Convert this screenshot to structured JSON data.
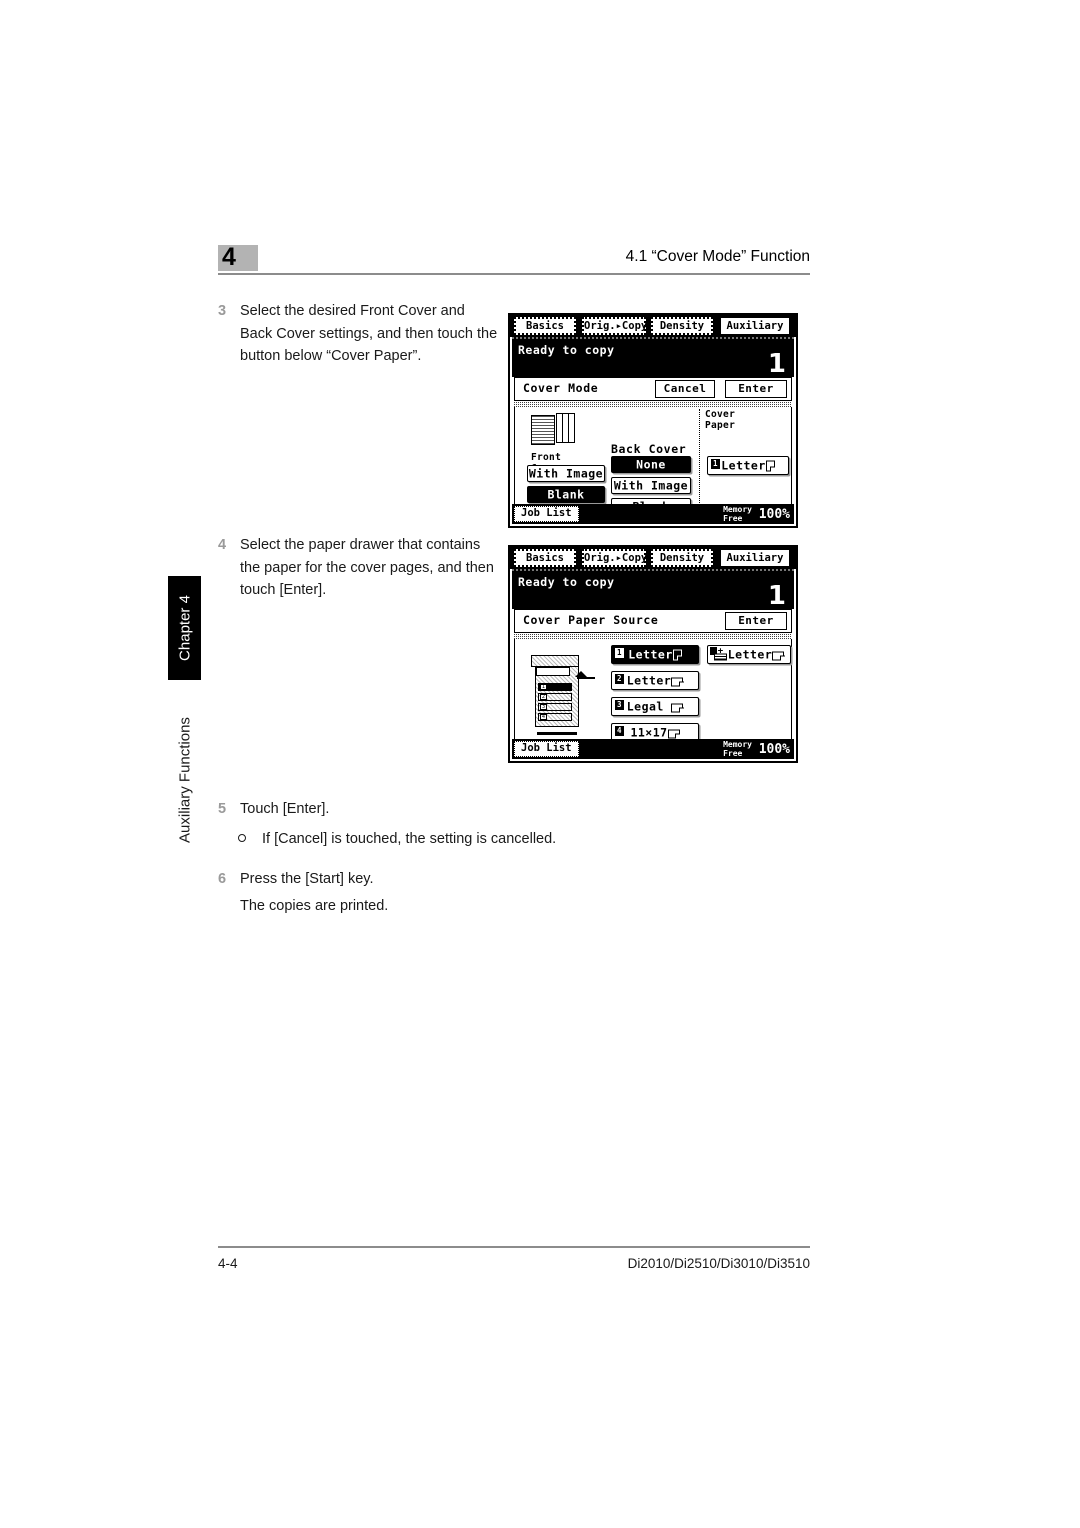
{
  "header": {
    "chapter_number": "4",
    "title": "4.1 “Cover Mode” Function"
  },
  "side_tab": {
    "chapter_label": "Chapter 4",
    "chapter_name": "Auxiliary Functions"
  },
  "steps": [
    {
      "number": "3",
      "text": "Select the desired Front Cover and Back Cover settings, and then touch the button below “Cover Paper”."
    },
    {
      "number": "4",
      "text": "Select the paper drawer that contains the paper for the cover pages, and then touch [Enter]."
    },
    {
      "number": "5",
      "text": "Touch [Enter]."
    },
    {
      "number": "6",
      "text": "Press the [Start] key."
    }
  ],
  "sub_bullet": "If [Cancel] is touched, the setting is cancelled.",
  "step6_sub": "The copies are printed.",
  "footer": {
    "page_number": "4-4",
    "model_line": "Di2010/Di2510/Di3010/Di3510"
  },
  "lcd1": {
    "tabs": [
      {
        "label": "Basics",
        "active": false
      },
      {
        "label": "Orig.▸Copy",
        "active": false
      },
      {
        "label": "Density",
        "active": false
      },
      {
        "label": "Auxiliary",
        "active": true
      }
    ],
    "status_text": "Ready to copy",
    "copy_count": "1",
    "mode_title": "Cover Mode",
    "cancel_label": "Cancel",
    "enter_label": "Enter",
    "front_cover_label": "Front Cover",
    "back_cover_label": "Back Cover",
    "cover_paper_label": "Cover Paper",
    "front_cover_options": [
      {
        "label": "With Image",
        "selected": false
      },
      {
        "label": "Blank",
        "selected": true
      }
    ],
    "back_cover_options": [
      {
        "label": "None",
        "selected": true
      },
      {
        "label": "With Image",
        "selected": false
      },
      {
        "label": "Blank",
        "selected": false
      }
    ],
    "cover_paper_button": {
      "tag": "1",
      "label": "Letter",
      "orientation": "portrait",
      "selected": false
    },
    "job_list_label": "Job List",
    "memory_label": "Memory Free",
    "memory_value": "100%"
  },
  "lcd2": {
    "tabs": [
      {
        "label": "Basics",
        "active": false
      },
      {
        "label": "Orig.▸Copy",
        "active": false
      },
      {
        "label": "Density",
        "active": false
      },
      {
        "label": "Auxiliary",
        "active": true
      }
    ],
    "status_text": "Ready to copy",
    "copy_count": "1",
    "mode_title": "Cover Paper Source",
    "enter_label": "Enter",
    "drawers": [
      {
        "tag": "1",
        "label": "Letter",
        "orientation": "portrait",
        "selected": true
      },
      {
        "tag": "2",
        "label": "Letter",
        "orientation": "landscape",
        "selected": false
      },
      {
        "tag": "3",
        "label": "Legal",
        "orientation": "landscape",
        "selected": false
      },
      {
        "tag": "4",
        "label": "11×17",
        "orientation": "landscape",
        "selected": false
      }
    ],
    "bypass": {
      "label": "Letter",
      "orientation": "landscape",
      "selected": false
    },
    "machine_drawers": [
      "1",
      "2",
      "3",
      "4"
    ],
    "machine_active_drawer": "1",
    "job_list_label": "Job List",
    "memory_label": "Memory Free",
    "memory_value": "100%"
  }
}
